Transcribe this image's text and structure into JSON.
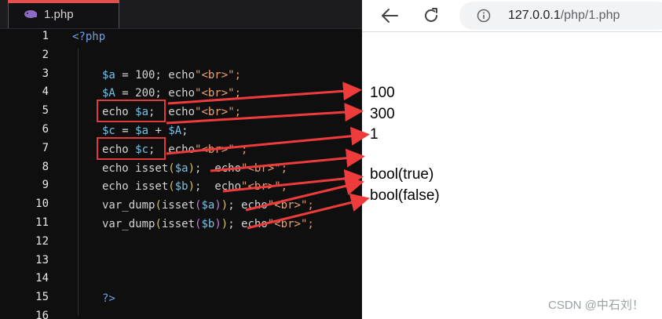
{
  "editor": {
    "tab": {
      "filename": "1.php"
    },
    "line_numbers": [
      "1",
      "2",
      "3",
      "4",
      "5",
      "6",
      "7",
      "8",
      "9",
      "10",
      "11",
      "12",
      "13",
      "14",
      "15",
      "16"
    ]
  },
  "code": {
    "l1": {
      "open_tag": "<?php"
    },
    "l3": {
      "v1": "$a",
      "t1": " = 100; echo",
      "s1": "\"",
      "s2": "<br>",
      "s3": "\";"
    },
    "l4": {
      "v1": "$A",
      "t1": " = 200; echo",
      "s1": "\"",
      "s2": "<br>",
      "s3": "\";"
    },
    "l5": {
      "k1": "echo ",
      "v1": "$a",
      "t1": ";  echo",
      "s1": "\"",
      "s2": "<br>",
      "s3": "\";"
    },
    "l6": {
      "v1": "$c",
      "t1": " = ",
      "v2": "$a",
      "t2": " + ",
      "v3": "$A",
      "t3": ";"
    },
    "l7": {
      "k1": "echo ",
      "v1": "$c",
      "t1": ";  echo",
      "s1": "\"",
      "s2": "<br>",
      "s3": "\" ;"
    },
    "l8": {
      "k1": "echo isset",
      "p1": "(",
      "v1": "$a",
      "p2": ")",
      "t1": ";  echo",
      "s1": "\"",
      "s2": "<br>",
      "s3": "\";"
    },
    "l9": {
      "k1": "echo isset",
      "p1": "(",
      "v1": "$b",
      "p2": ")",
      "t1": ";  echo",
      "s1": "\"",
      "s2": "<br>",
      "s3": "\";"
    },
    "l10": {
      "k1": "var_dump",
      "p1": "(",
      "k2": "isset",
      "p3": "(",
      "v1": "$a",
      "p4": ")",
      "p2": ")",
      "t1": "; echo",
      "s1": "\"",
      "s2": "<br>",
      "s3": "\";"
    },
    "l11": {
      "k1": "var_dump",
      "p1": "(",
      "k2": "isset",
      "p3": "(",
      "v1": "$b",
      "p4": ")",
      "p2": ")",
      "t1": "; echo",
      "s1": "\"",
      "s2": "<br>",
      "s3": "\";"
    },
    "l15": {
      "close_tag": "?>"
    }
  },
  "browser": {
    "url_host": "127.0.0.1",
    "url_path": "/php/1.php",
    "output": [
      "100",
      "300",
      "1",
      "bool(true)",
      "bool(false)"
    ],
    "watermark": "CSDN @中石刘！"
  },
  "colors": {
    "accent_red": "#e03a3a",
    "editor_bg": "#0f0f10",
    "variable": "#77c3e6",
    "keyword": "#e08a5a"
  },
  "icons": {
    "tab": "php-elephant-icon",
    "back": "back-arrow-icon",
    "reload": "reload-icon",
    "info": "info-icon"
  }
}
